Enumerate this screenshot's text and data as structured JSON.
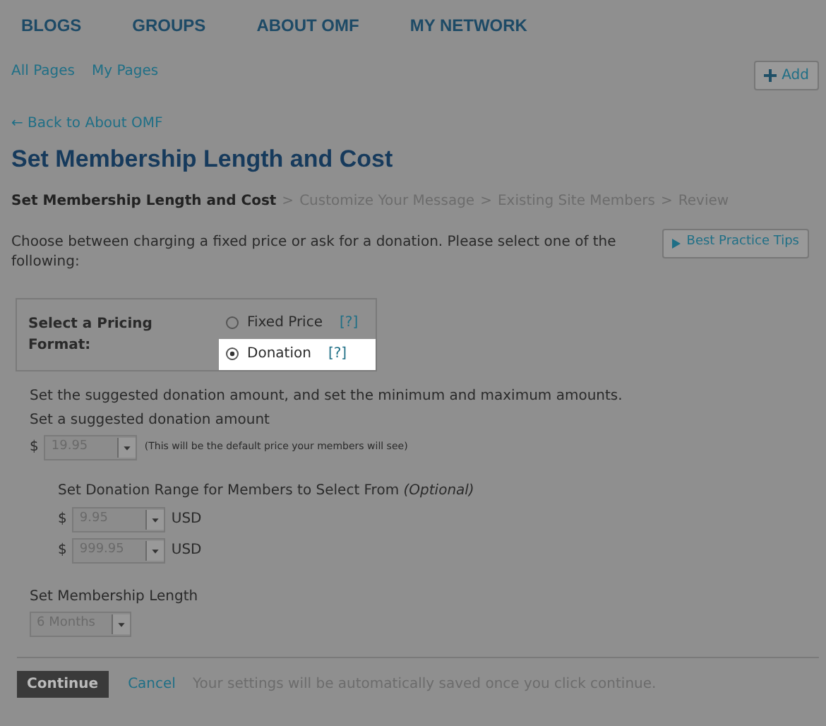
{
  "nav": [
    "BLOGS",
    "GROUPS",
    "ABOUT OMF",
    "MY NETWORK"
  ],
  "subnav": [
    "All Pages",
    "My Pages"
  ],
  "add_button": "Add",
  "back_link": "← Back to About OMF",
  "title": "Set Membership Length and Cost",
  "steps": [
    {
      "label": "Set Membership Length and Cost",
      "selected": true
    },
    {
      "label": "Customize Your Message",
      "selected": false
    },
    {
      "label": "Existing Site Members",
      "selected": false
    },
    {
      "label": "Review",
      "selected": false
    }
  ],
  "step_separator": ">",
  "intro": "Choose between charging a fixed price or ask for a donation. Please select one of the following:",
  "tips_button": "Best Practice Tips",
  "pricing": {
    "label": "Select a Pricing Format:",
    "options": [
      {
        "label": "Fixed Price",
        "help": "[?]",
        "selected": false
      },
      {
        "label": "Donation",
        "help": "[?]",
        "selected": true
      }
    ]
  },
  "donation": {
    "description": "Set the suggested donation amount, and set the minimum and maximum amounts.",
    "suggested_label": "Set a suggested donation amount",
    "currency": "$",
    "suggested_value": "19.95",
    "suggested_note": "(This will be the default price your members will see)",
    "range_label": "Set Donation Range for Members to Select From *(Optional)*",
    "range": [
      {
        "currency": "$",
        "value": "9.95",
        "unit": "USD"
      },
      {
        "currency": "$",
        "value": "999.95",
        "unit": "USD"
      }
    ]
  },
  "length": {
    "label": "Set Membership Length",
    "value": "6 Months"
  },
  "footer": {
    "continue": "Continue",
    "cancel": "Cancel",
    "note": "Your settings will be automatically saved once you click continue."
  }
}
